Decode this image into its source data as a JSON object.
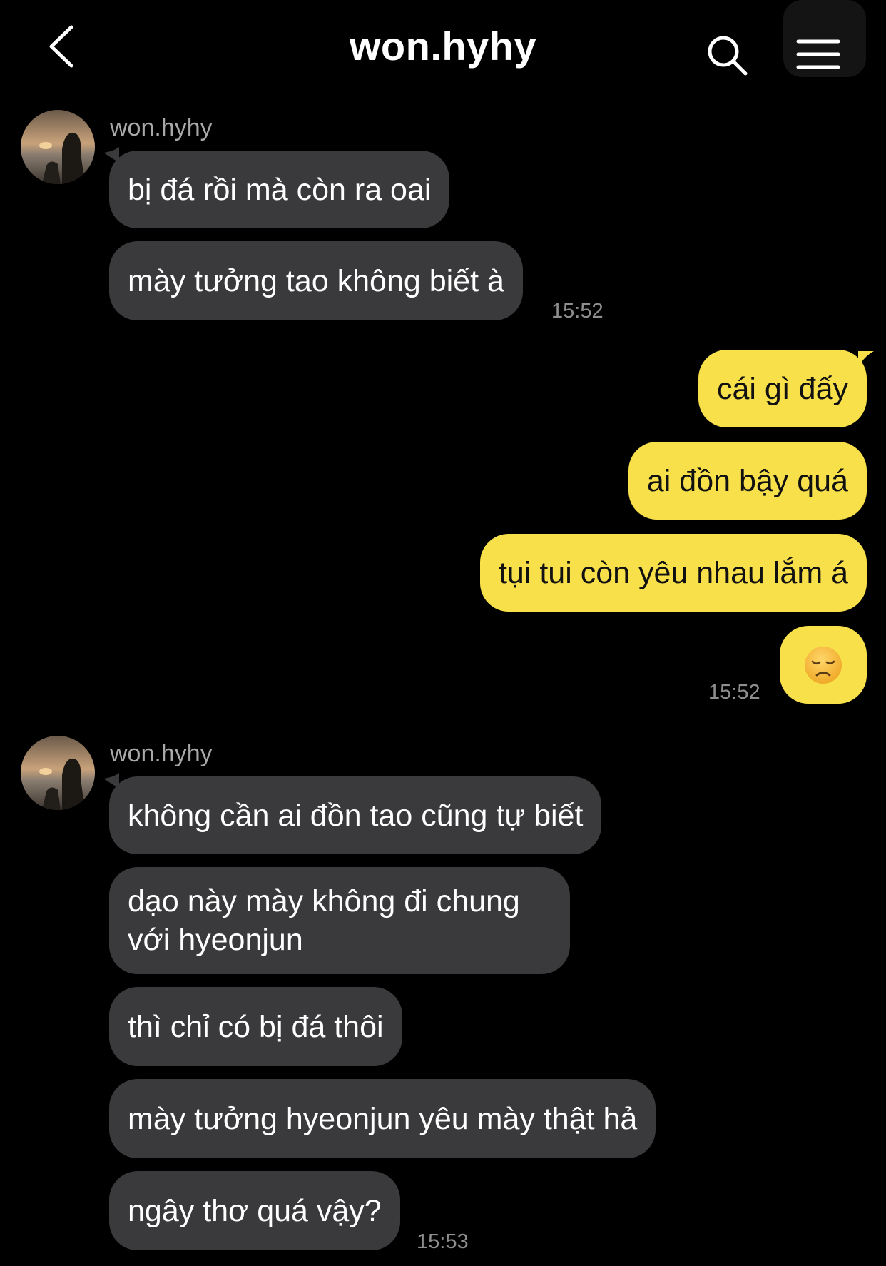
{
  "header": {
    "title": "won.hyhy"
  },
  "messages": [
    {
      "sender": "won.hyhy",
      "bubbles": [
        "bị đá rồi mà còn ra oai",
        "mày tưởng tao không biết à"
      ],
      "time": "15:52"
    },
    {
      "bubbles": [
        "cái gì đấy",
        "ai đồn bậy quá",
        "tụi tui còn yêu nhau lắm á"
      ],
      "emoji": "disappointed-face",
      "time": "15:52"
    },
    {
      "sender": "won.hyhy",
      "bubbles": [
        "không cần ai đồn tao cũng tự biết",
        "dạo này mày không đi chung",
        "với hyeonjun",
        "thì chỉ có bị đá thôi",
        "mày tưởng hyeonjun yêu mày thật hả",
        "ngây thơ quá vậy?"
      ],
      "time": "15:53"
    }
  ],
  "colors": {
    "background": "#000000",
    "incoming_bubble": "#3a3a3c",
    "outgoing_bubble": "#f8e04b",
    "timestamp": "#8e8e8e"
  },
  "icons": [
    "back-chevron-icon",
    "search-icon",
    "menu-icon",
    "disappointed-face-emoji"
  ]
}
